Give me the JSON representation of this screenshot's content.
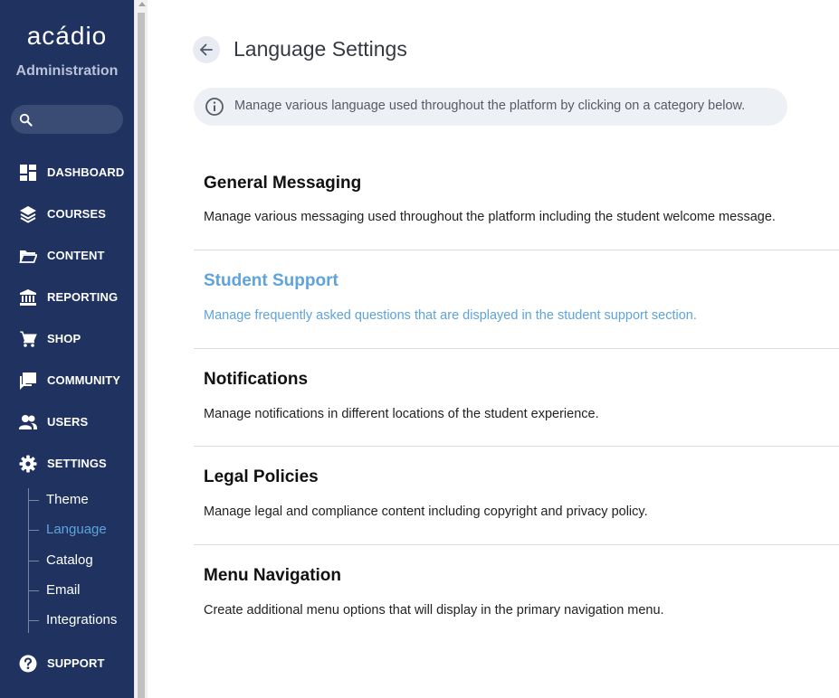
{
  "sidebar": {
    "logo": "acádio",
    "subtitle": "Administration",
    "nav": [
      {
        "label": "DASHBOARD",
        "icon": "dashboard-icon"
      },
      {
        "label": "COURSES",
        "icon": "layers-icon"
      },
      {
        "label": "CONTENT",
        "icon": "folder-icon"
      },
      {
        "label": "REPORTING",
        "icon": "bank-icon"
      },
      {
        "label": "SHOP",
        "icon": "cart-icon"
      },
      {
        "label": "COMMUNITY",
        "icon": "chat-icon"
      },
      {
        "label": "USERS",
        "icon": "users-icon"
      },
      {
        "label": "SETTINGS",
        "icon": "gear-icon"
      }
    ],
    "settings_sub": [
      {
        "label": "Theme"
      },
      {
        "label": "Language",
        "active": true
      },
      {
        "label": "Catalog"
      },
      {
        "label": "Email"
      },
      {
        "label": "Integrations"
      }
    ],
    "support": {
      "label": "SUPPORT",
      "icon": "help-icon"
    }
  },
  "header": {
    "title": "Language Settings",
    "back_icon": "arrow-left-icon"
  },
  "info": {
    "icon": "info-icon",
    "text": "Manage various language used throughout the platform by clicking on a category below."
  },
  "categories": [
    {
      "title": "General Messaging",
      "description": "Manage various messaging used throughout the platform including the student welcome message."
    },
    {
      "title": "Student Support",
      "description": "Manage frequently asked questions that are displayed in the student support section."
    },
    {
      "title": "Notifications",
      "description": "Manage notifications in different locations of the student experience."
    },
    {
      "title": "Legal Policies",
      "description": "Manage legal and compliance content including copyright and privacy policy."
    },
    {
      "title": "Menu Navigation",
      "description": "Create additional menu options that will display in the primary navigation menu."
    }
  ],
  "colors": {
    "sidebar_bg": "#1f3260",
    "accent": "#5ea3dc",
    "banner_bg": "#edf0f4"
  }
}
